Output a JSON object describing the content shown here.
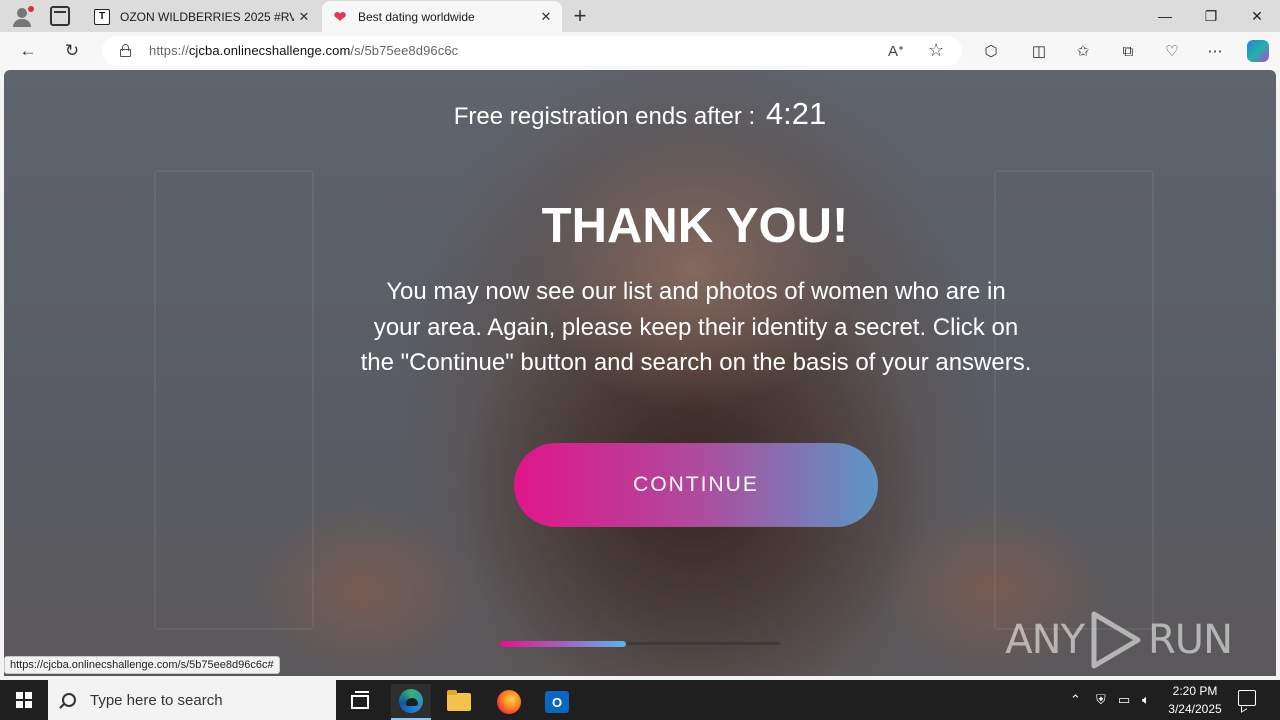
{
  "browser": {
    "tabs": [
      {
        "title": "OZON WILDBERRIES 2025 #RVATI",
        "favicon": "T"
      },
      {
        "title": "Best dating worldwide",
        "favicon": "❤",
        "active": true
      }
    ],
    "url": {
      "prefix": "https://",
      "domain": "cjcba.onlinecshallenge.com",
      "path": "/s/5b75ee8d96c6c"
    },
    "status_bar_url": "https://cjcba.onlinecshallenge.com/s/5b75ee8d96c6c#"
  },
  "page": {
    "timer_label": "Free registration ends after :",
    "timer_value": "4:21",
    "heading": "THANK YOU!",
    "message": "You may now see our list and photos of women who are in your area. Again, please keep their identity a secret. Click on the \"Continue\" button and search on the basis of your answers.",
    "continue_label": "CONTINUE",
    "progress_fraction": 0.45,
    "accent_colors": {
      "pink": "#e0168a",
      "blue": "#5c96c6"
    }
  },
  "watermark": {
    "left": "ANY",
    "right": "RUN"
  },
  "taskbar": {
    "search_placeholder": "Type here to search",
    "time": "2:20 PM",
    "date": "3/24/2025",
    "pinned": [
      "task-view-icon",
      "edge-icon",
      "file-explorer-icon",
      "firefox-icon",
      "outlook-icon"
    ]
  }
}
